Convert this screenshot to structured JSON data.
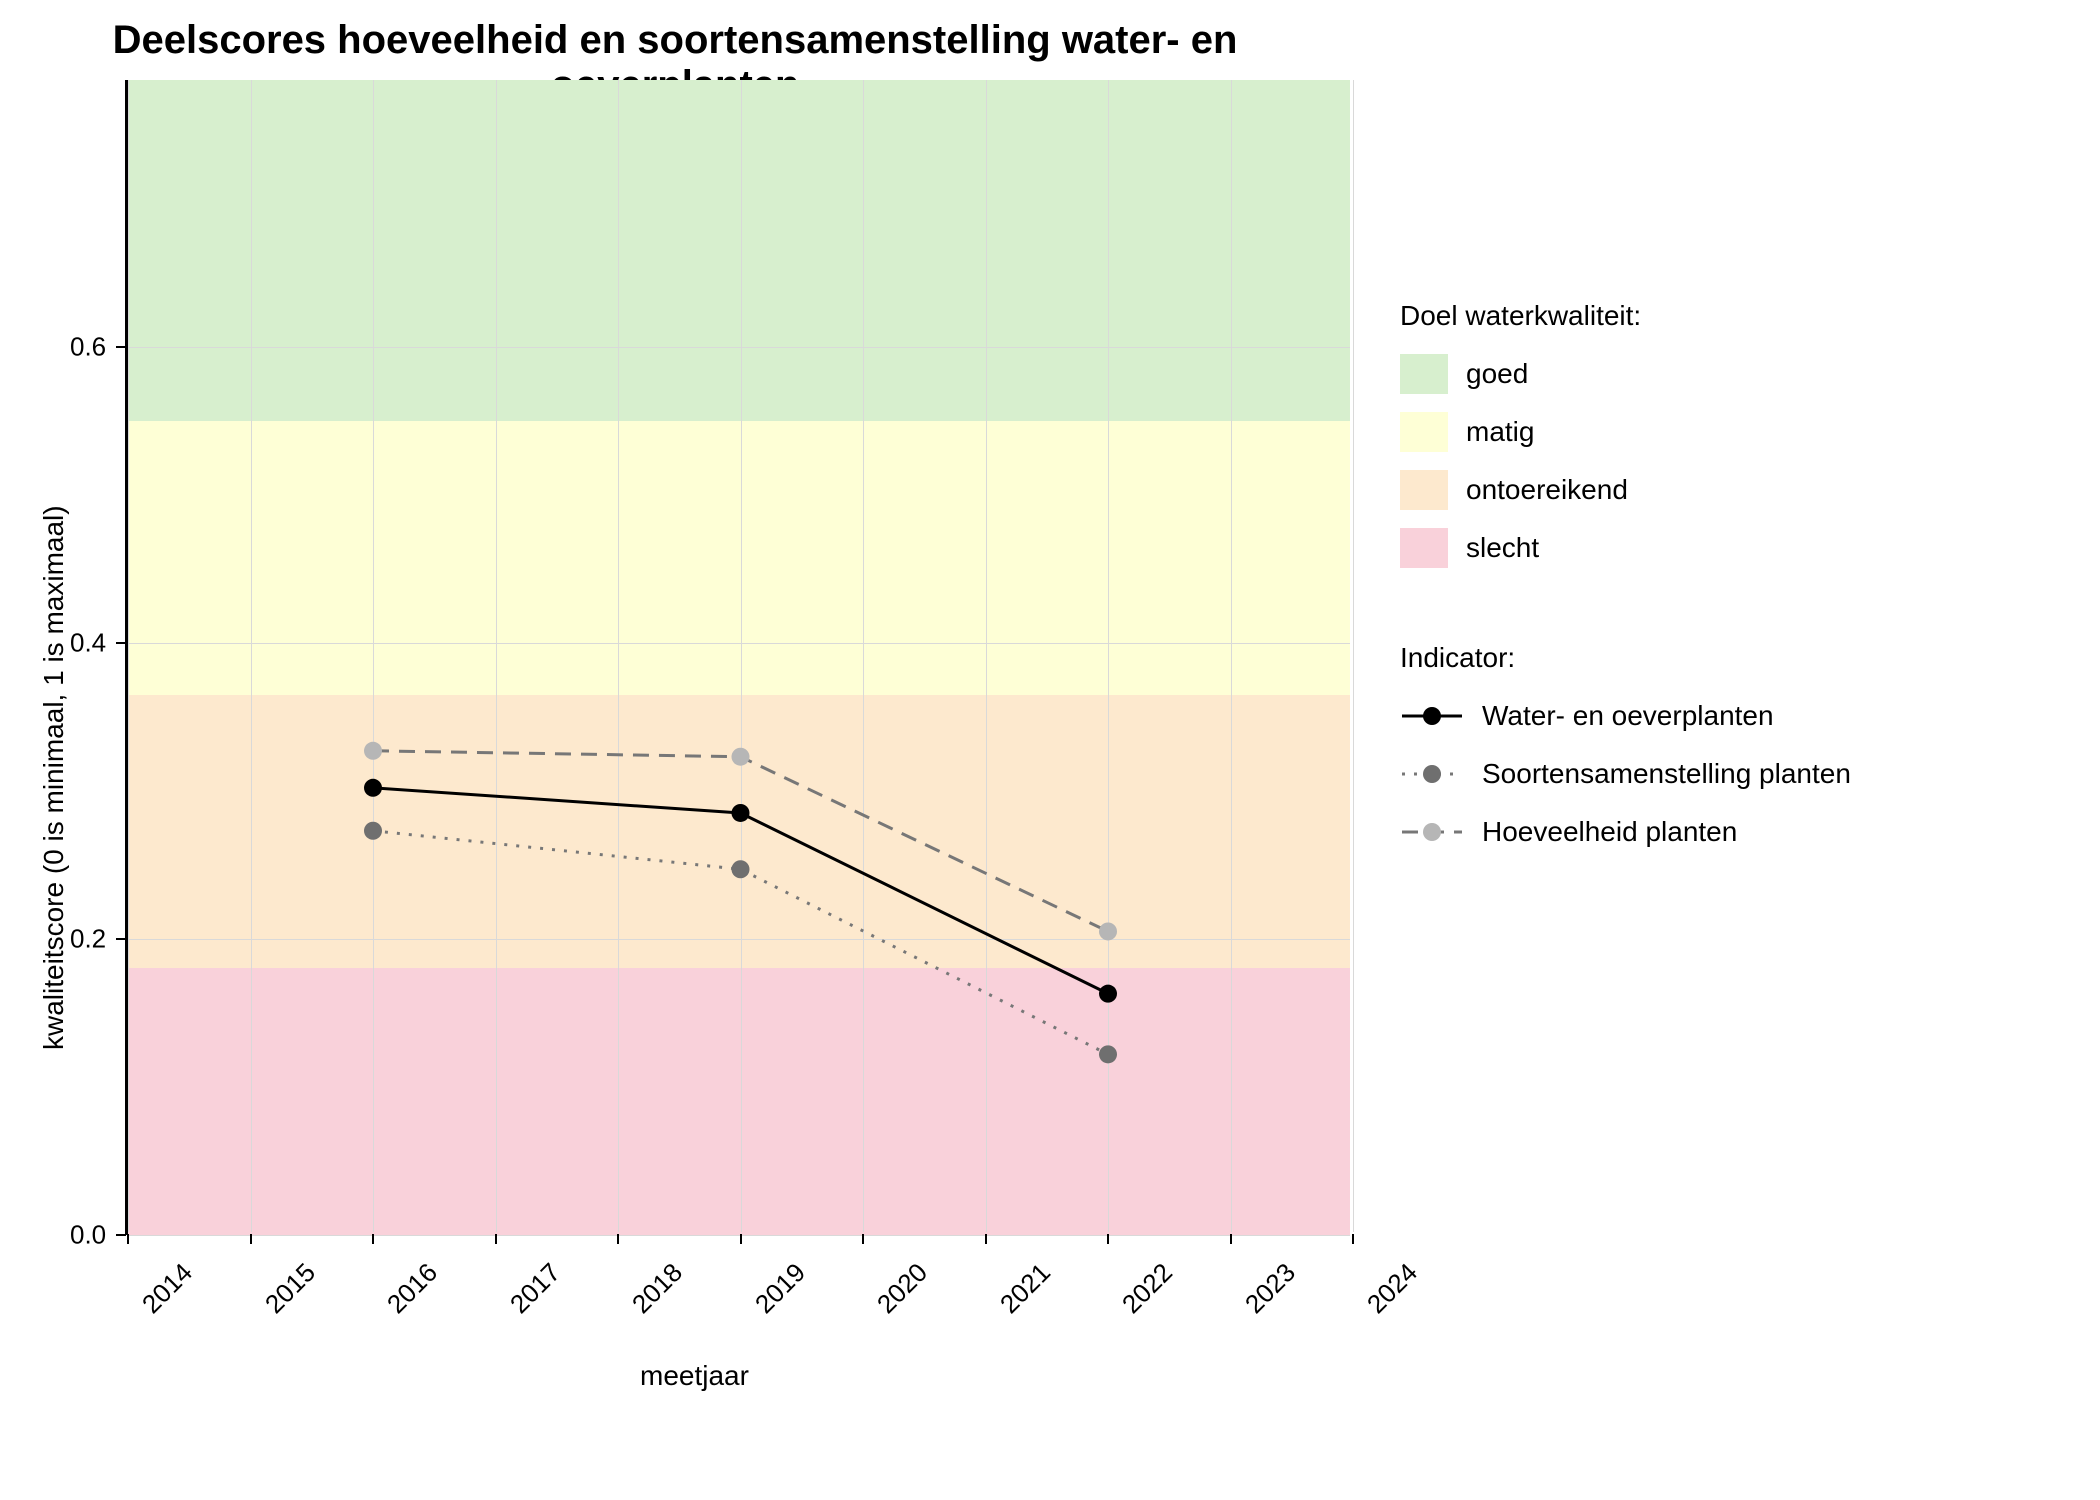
{
  "chart_data": {
    "type": "line",
    "title": "Deelscores hoeveelheid en soortensamenstelling water- en oeverplanten",
    "xlabel": "meetjaar",
    "ylabel": "kwaliteitscore (0 is minimaal, 1 is maximaal)",
    "x_ticks": [
      2014,
      2015,
      2016,
      2017,
      2018,
      2019,
      2020,
      2021,
      2022,
      2023,
      2024
    ],
    "y_ticks": [
      0.0,
      0.2,
      0.4,
      0.6
    ],
    "xlim": [
      2014,
      2024
    ],
    "ylim": [
      0.0,
      0.78
    ],
    "quality_bands": [
      {
        "name": "slecht",
        "from": 0.0,
        "to": 0.18,
        "color": "#f9d1da"
      },
      {
        "name": "ontoereikend",
        "from": 0.18,
        "to": 0.365,
        "color": "#fde9ce"
      },
      {
        "name": "matig",
        "from": 0.365,
        "to": 0.55,
        "color": "#feffd6"
      },
      {
        "name": "goed",
        "from": 0.55,
        "to": 0.78,
        "color": "#d7efce"
      }
    ],
    "x": [
      2016,
      2019,
      2022
    ],
    "series": [
      {
        "name": "Water- en oeverplanten",
        "values": [
          0.302,
          0.285,
          0.163
        ],
        "color": "#000000",
        "dash": "solid",
        "point_color": "#000000"
      },
      {
        "name": "Soortensamenstelling planten",
        "values": [
          0.273,
          0.247,
          0.122
        ],
        "color": "#777777",
        "dash": "dotted",
        "point_color": "#6f6f6f"
      },
      {
        "name": "Hoeveelheid planten",
        "values": [
          0.327,
          0.323,
          0.205
        ],
        "color": "#777777",
        "dash": "dashed",
        "point_color": "#b6b6b6"
      }
    ],
    "legend_band_title": "Doel waterkwaliteit:",
    "legend_series_title": "Indicator:",
    "legend_band_order": [
      "goed",
      "matig",
      "ontoereikend",
      "slecht"
    ]
  }
}
